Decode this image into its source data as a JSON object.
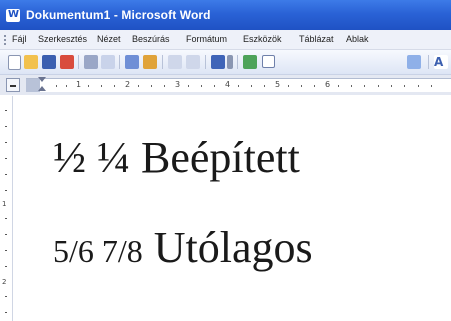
{
  "window": {
    "title": "Dokumentum1 - Microsoft Word"
  },
  "menu": {
    "items": [
      "Fájl",
      "Szerkesztés",
      "Nézet",
      "Beszúrás",
      "Formátum",
      "Eszközök",
      "Táblázat",
      "Ablak"
    ]
  },
  "toolbar": {
    "buttons": [
      "new-icon",
      "open-icon",
      "save-icon",
      "permission-icon",
      "print-icon",
      "print-preview-icon",
      "spelling-icon",
      "research-icon",
      "cut-icon",
      "copy-icon",
      "undo-icon",
      "insert-hyperlink-icon",
      "table-icon",
      "drawing-icon"
    ]
  },
  "ruler": {
    "numbers": [
      "1",
      "2",
      "3",
      "4",
      "5",
      "6"
    ]
  },
  "vertical_ruler": {
    "numbers": [
      "1",
      "2"
    ]
  },
  "document": {
    "line1_prefix": "½ ¼",
    "line1_word": "Beépített",
    "line2_prefix": "5/6 7/8",
    "line2_word": "Utólagos"
  },
  "colors": {
    "titlebar": "#2a62d6",
    "menubar": "#eef1f9",
    "text": "#1a1a1a"
  }
}
